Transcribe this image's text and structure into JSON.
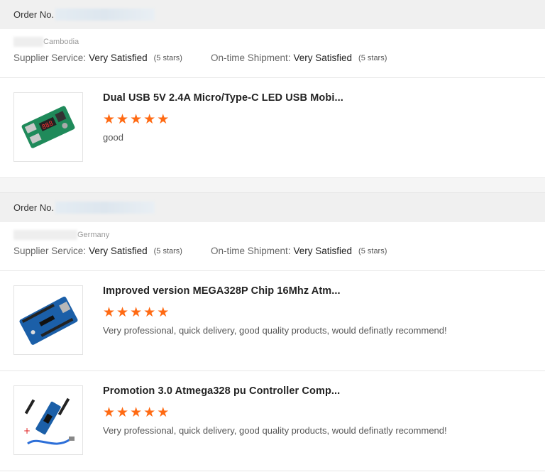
{
  "orders": [
    {
      "order_label": "Order No.",
      "country": "Cambodia",
      "supplier_service_label": "Supplier Service:",
      "supplier_service_value": "Very Satisfied",
      "supplier_service_stars": "(5 stars)",
      "shipment_label": "On-time Shipment:",
      "shipment_value": "Very Satisfied",
      "shipment_stars": "(5 stars)",
      "products": [
        {
          "title": "Dual USB 5V 2.4A Micro/Type-C LED USB Mobi...",
          "rating": 5,
          "comment": "good",
          "image_icon": "usb-power-board-image"
        }
      ]
    },
    {
      "order_label": "Order No.",
      "country": "Germany",
      "supplier_service_label": "Supplier Service:",
      "supplier_service_value": "Very Satisfied",
      "supplier_service_stars": "(5 stars)",
      "shipment_label": "On-time Shipment:",
      "shipment_value": "Very Satisfied",
      "shipment_stars": "(5 stars)",
      "products": [
        {
          "title": "Improved version MEGA328P Chip 16Mhz Atm...",
          "rating": 5,
          "comment": "Very professional, quick delivery, good quality products, would definatly recommend!",
          "image_icon": "uno-board-image"
        },
        {
          "title": "Promotion 3.0 Atmega328 pu Controller Comp...",
          "rating": 5,
          "comment": "Very professional, quick delivery, good quality products, would definatly recommend!",
          "image_icon": "nano-board-image"
        }
      ]
    }
  ],
  "colors": {
    "star": "#ff6a13",
    "header_bg": "#f0f0f0"
  }
}
